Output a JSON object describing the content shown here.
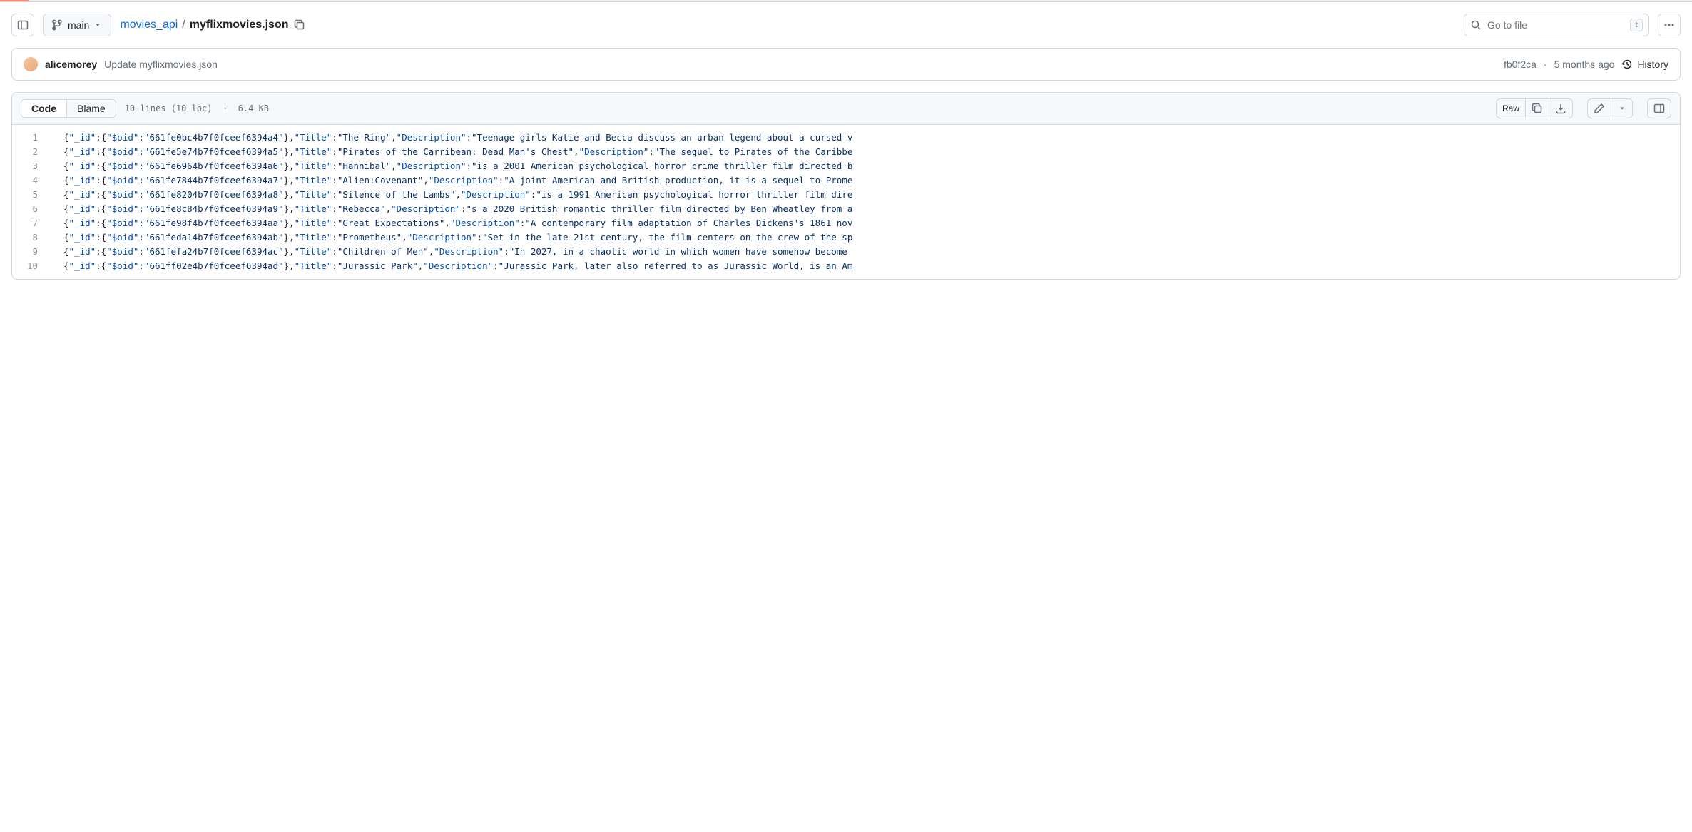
{
  "branch": "main",
  "breadcrumb": {
    "repo": "movies_api",
    "sep": "/",
    "file": "myflixmovies.json"
  },
  "search": {
    "placeholder": "Go to file",
    "shortcut": "t"
  },
  "commit": {
    "author": "alicemorey",
    "message": "Update myflixmovies.json",
    "sha": "fb0f2ca",
    "date": "5 months ago",
    "history": "History"
  },
  "tabs": {
    "code": "Code",
    "blame": "Blame"
  },
  "file_info": {
    "lines": "10 lines (10 loc)",
    "dot": "·",
    "size": "6.4 KB"
  },
  "actions": {
    "raw": "Raw"
  },
  "code_lines": [
    {
      "n": 1,
      "oid": "661fe0bc4b7f0fceef6394a4",
      "title": "The Ring",
      "desc": "Teenage girls Katie and Becca discuss an urban legend about a cursed v"
    },
    {
      "n": 2,
      "oid": "661fe5e74b7f0fceef6394a5",
      "title": "Pirates of the Carribean: Dead Man's Chest",
      "desc": "The sequel to Pirates of the Caribbe"
    },
    {
      "n": 3,
      "oid": "661fe6964b7f0fceef6394a6",
      "title": "Hannibal",
      "desc": "is a 2001 American psychological horror crime thriller film directed b"
    },
    {
      "n": 4,
      "oid": "661fe7844b7f0fceef6394a7",
      "title": "Alien:Covenant",
      "desc": "A joint American and British production, it is a sequel to Prome"
    },
    {
      "n": 5,
      "oid": "661fe8204b7f0fceef6394a8",
      "title": "Silence of the Lambs",
      "desc": "is a 1991 American psychological horror thriller film dire"
    },
    {
      "n": 6,
      "oid": "661fe8c84b7f0fceef6394a9",
      "title": "Rebecca",
      "desc": "s a 2020 British romantic thriller film directed by Ben Wheatley from a"
    },
    {
      "n": 7,
      "oid": "661fe98f4b7f0fceef6394aa",
      "title": "Great Expectations",
      "desc": "A contemporary film adaptation of Charles Dickens's 1861 nov"
    },
    {
      "n": 8,
      "oid": "661feda14b7f0fceef6394ab",
      "title": "Prometheus",
      "desc": "Set in the late 21st century, the film centers on the crew of the sp"
    },
    {
      "n": 9,
      "oid": "661fefa24b7f0fceef6394ac",
      "title": "Children of Men",
      "desc": "In 2027, in a chaotic world in which women have somehow become "
    },
    {
      "n": 10,
      "oid": "661ff02e4b7f0fceef6394ad",
      "title": "Jurassic Park",
      "desc": "Jurassic Park, later also referred to as Jurassic World, is an Am"
    }
  ]
}
